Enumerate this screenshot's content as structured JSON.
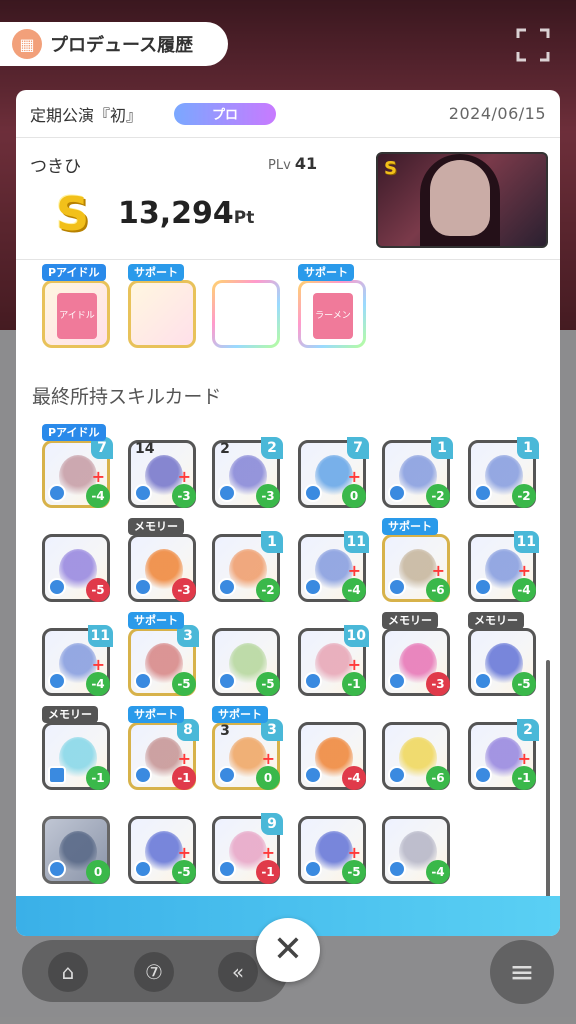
{
  "header": {
    "title": "プロデュース履歴",
    "icon": "history-icon"
  },
  "panel": {
    "event_name": "定期公演『初』",
    "difficulty": "プロ",
    "date": "2024/06/15",
    "idol_name": "つきひ",
    "plv_label": "PLv",
    "plv_value": "41",
    "rank": "S",
    "score": "13,294",
    "score_unit": "Pt"
  },
  "items": [
    {
      "tag": "Pアイドル",
      "tag_type": "p",
      "art": "アイドル誌",
      "rainbow": false
    },
    {
      "tag": "サポート",
      "tag_type": "s",
      "art": "",
      "rainbow": false
    },
    {
      "tag": "",
      "tag_type": "",
      "art": "",
      "rainbow": true
    },
    {
      "tag": "サポート",
      "tag_type": "s",
      "art": "ラーメン",
      "rainbow": true
    }
  ],
  "section_label": "最終所持スキルカード",
  "cards": [
    {
      "tag": "Pアイドル",
      "tag_type": "p",
      "cost_top": "7",
      "cost": "-4",
      "badge": "green",
      "color": "#c8a0a8",
      "plus": true
    },
    {
      "tag": "",
      "tag_type": "",
      "cost_top": "14",
      "top_white": true,
      "cost": "-3",
      "badge": "green",
      "color": "#7a7acc",
      "plus": true
    },
    {
      "tag": "",
      "tag_type": "",
      "cost_top": "2",
      "cost_top2": "2",
      "cost": "-3",
      "badge": "green",
      "color": "#8a8ad8",
      "plus": false
    },
    {
      "tag": "",
      "tag_type": "",
      "cost_top": "7",
      "cost": "0",
      "badge": "green",
      "color": "#6aa8e8",
      "plus": true
    },
    {
      "tag": "",
      "tag_type": "",
      "cost_top": "1",
      "cost": "-2",
      "badge": "green",
      "color": "#8aa0e0",
      "plus": false
    },
    {
      "tag": "",
      "tag_type": "",
      "cost_top": "1",
      "cost": "-2",
      "badge": "green",
      "color": "#8aa0e0",
      "plus": false
    },
    {
      "tag": "",
      "tag_type": "",
      "cost_top": "",
      "cost": "-5",
      "badge": "red",
      "color": "#9a8ae0",
      "plus": false
    },
    {
      "tag": "メモリー",
      "tag_type": "m",
      "cost_top": "",
      "cost": "-3",
      "badge": "red",
      "color": "#f08a40",
      "plus": false
    },
    {
      "tag": "",
      "tag_type": "",
      "cost_top": "1",
      "cost": "-2",
      "badge": "green",
      "color": "#f0a070",
      "plus": false
    },
    {
      "tag": "",
      "tag_type": "",
      "cost_top": "11",
      "cost": "-4",
      "badge": "green",
      "color": "#8aa0e0",
      "plus": true
    },
    {
      "tag": "サポート",
      "tag_type": "s",
      "cost_top": "",
      "cost": "-6",
      "badge": "green",
      "color": "#c8b8a0",
      "plus": true
    },
    {
      "tag": "",
      "tag_type": "",
      "cost_top": "11",
      "cost": "-4",
      "badge": "green",
      "color": "#8aa0e0",
      "plus": true
    },
    {
      "tag": "",
      "tag_type": "",
      "cost_top": "11",
      "cost": "-4",
      "badge": "green",
      "color": "#8aa0e0",
      "plus": true
    },
    {
      "tag": "サポート",
      "tag_type": "s",
      "cost_top": "3",
      "cost": "-5",
      "badge": "green",
      "color": "#d88a8a",
      "plus": false
    },
    {
      "tag": "",
      "tag_type": "",
      "cost_top": "",
      "cost": "-5",
      "badge": "green",
      "color": "#b8d8a0",
      "plus": false
    },
    {
      "tag": "",
      "tag_type": "",
      "cost_top": "10",
      "cost": "-1",
      "badge": "green",
      "color": "#e8a8b8",
      "plus": true
    },
    {
      "tag": "メモリー",
      "tag_type": "m",
      "cost_top": "",
      "cost": "-3",
      "badge": "red",
      "color": "#e87ab8",
      "plus": false
    },
    {
      "tag": "メモリー",
      "tag_type": "m",
      "cost_top": "",
      "cost": "-5",
      "badge": "green",
      "color": "#6a7ad8",
      "plus": false
    },
    {
      "tag": "メモリー",
      "tag_type": "m",
      "cost_top": "",
      "cost": "-1",
      "badge": "green",
      "color": "#8ad8e8",
      "plus": false
    },
    {
      "tag": "サポート",
      "tag_type": "s",
      "cost_top": "8",
      "cost": "-1",
      "badge": "red",
      "color": "#c89898",
      "plus": true
    },
    {
      "tag": "サポート",
      "tag_type": "s",
      "cost_top": "3",
      "cost_top2": "3",
      "cost": "0",
      "badge": "green",
      "color": "#f0a868",
      "plus": true
    },
    {
      "tag": "",
      "tag_type": "",
      "cost_top": "",
      "cost": "-4",
      "badge": "red",
      "color": "#f08a40",
      "plus": false
    },
    {
      "tag": "",
      "tag_type": "",
      "cost_top": "",
      "cost": "-6",
      "badge": "green",
      "color": "#f0d860",
      "plus": false
    },
    {
      "tag": "",
      "tag_type": "",
      "cost_top": "2",
      "cost": "-1",
      "badge": "green",
      "color": "#9a8ae0",
      "plus": true
    },
    {
      "tag": "",
      "tag_type": "",
      "cost_top": "",
      "cost": "0",
      "badge": "green",
      "color": "#5a6a88",
      "plus": false,
      "gray": true
    },
    {
      "tag": "",
      "tag_type": "",
      "cost_top": "",
      "cost": "-5",
      "badge": "green",
      "color": "#6a7ad8",
      "plus": true
    },
    {
      "tag": "",
      "tag_type": "",
      "cost_top": "9",
      "cost": "-1",
      "badge": "red",
      "color": "#e8a8c8",
      "plus": true
    },
    {
      "tag": "",
      "tag_type": "",
      "cost_top": "",
      "cost": "-5",
      "badge": "green",
      "color": "#6a7ad8",
      "plus": true
    },
    {
      "tag": "",
      "tag_type": "",
      "cost_top": "",
      "cost": "-4",
      "badge": "green",
      "color": "#b8b8c8",
      "plus": false
    }
  ],
  "nav": {
    "home": "⌂",
    "gacha": "⑦",
    "back": "«",
    "menu": "≡",
    "close": "✕"
  }
}
